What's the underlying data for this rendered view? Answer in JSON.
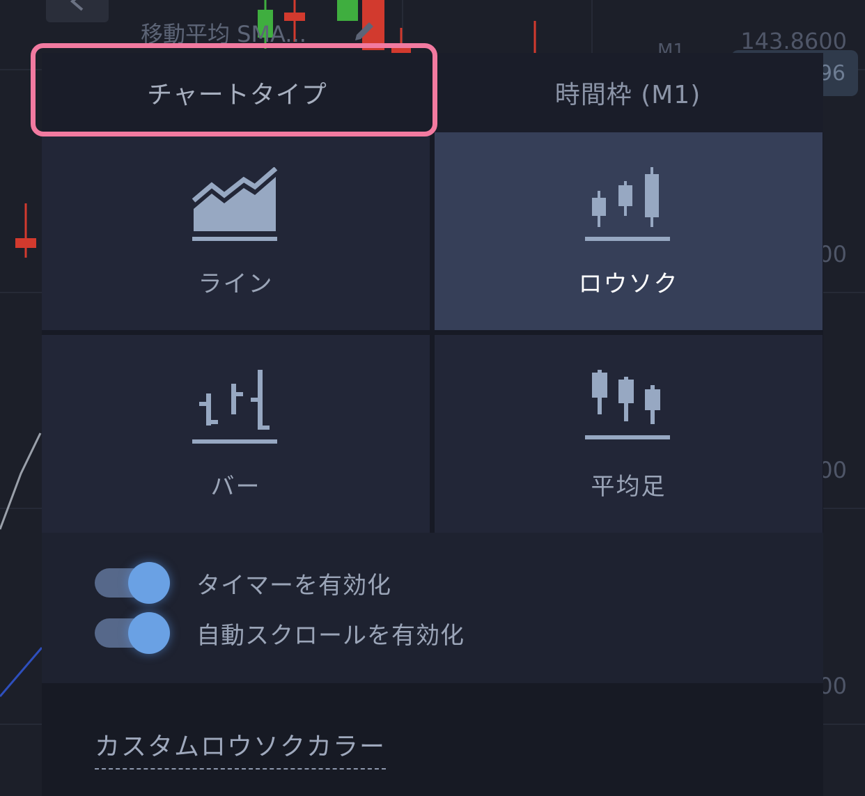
{
  "background": {
    "indicator_label": "移動平均 SMA...",
    "timeframe": "M1",
    "prices": [
      "143.8600",
      "00",
      "00",
      "00"
    ],
    "price_badge": "96"
  },
  "tabs": [
    {
      "label": "チャートタイプ",
      "active": true
    },
    {
      "label": "時間枠 (M1)",
      "active": false
    }
  ],
  "chart_types": [
    {
      "label": "ライン",
      "icon": "line-chart-icon",
      "selected": false
    },
    {
      "label": "ロウソク",
      "icon": "candlestick-icon",
      "selected": true
    },
    {
      "label": "バー",
      "icon": "bar-chart-icon",
      "selected": false
    },
    {
      "label": "平均足",
      "icon": "heikin-ashi-icon",
      "selected": false
    }
  ],
  "toggles": [
    {
      "label": "タイマーを有効化",
      "on": true
    },
    {
      "label": "自動スクロールを有効化",
      "on": true
    }
  ],
  "custom_colors_link": "カスタムロウソクカラー",
  "colors": {
    "panel": "#1a1d29",
    "tile": "#222637",
    "tile_selected": "#363f58",
    "icon": "#97a8c2",
    "toggle_knob": "#6aa1e4",
    "highlight": "#f27aa0"
  }
}
